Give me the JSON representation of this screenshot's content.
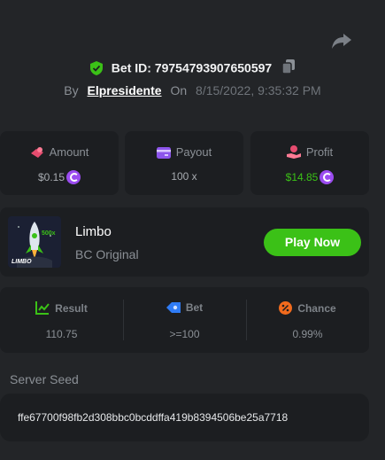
{
  "header": {
    "bet_id_label": "Bet ID:",
    "bet_id": "79754793907650597",
    "by_label": "By",
    "username": "Elpresidente",
    "on_label": "On",
    "datetime": "8/15/2022, 9:35:32 PM"
  },
  "stats": {
    "amount": {
      "label": "Amount",
      "value": "$0.15"
    },
    "payout": {
      "label": "Payout",
      "value": "100 x"
    },
    "profit": {
      "label": "Profit",
      "value": "$14.85"
    }
  },
  "game": {
    "name": "Limbo",
    "subtitle": "BC Original",
    "play_label": "Play Now",
    "thumb_text": "LIMBO",
    "thumb_multiplier": "500x"
  },
  "result_panel": {
    "result": {
      "label": "Result",
      "value": "110.75"
    },
    "bet": {
      "label": "Bet",
      "value": ">=100"
    },
    "chance": {
      "label": "Chance",
      "value": "0.99%"
    }
  },
  "server_seed": {
    "label": "Server Seed",
    "value": "ffe67700f98fb2d308bbc0bcddffa419b8394506be25a7718"
  },
  "colors": {
    "background": "#232528",
    "card": "#1c1e21",
    "accent_green": "#3bc117",
    "coin_purple": "#9b4cf0"
  },
  "icons": [
    "share-icon",
    "shield-check-icon",
    "copy-icon",
    "amount-icon",
    "payout-icon",
    "profit-icon",
    "coin-icon",
    "result-icon",
    "bet-icon",
    "chance-icon"
  ]
}
